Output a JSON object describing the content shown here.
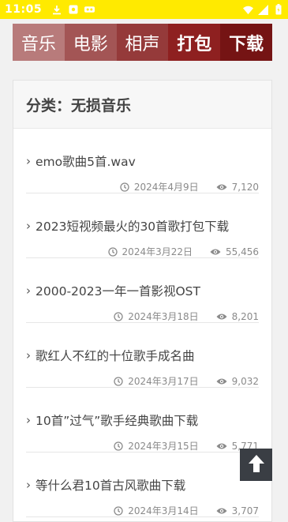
{
  "status_bar": {
    "time": "11:05",
    "icons": [
      "download-icon",
      "app-icon",
      "voicemail-icon",
      "wifi-icon",
      "signal-icon",
      "battery-icon"
    ]
  },
  "nav": {
    "tabs": [
      {
        "label": "音乐",
        "color": "#b87b7b"
      },
      {
        "label": "电影",
        "color": "#a35555"
      },
      {
        "label": "相声",
        "color": "#953a3a"
      },
      {
        "label": "打包",
        "color": "#8e2020"
      },
      {
        "label": "下载",
        "color": "#751414"
      }
    ]
  },
  "category": {
    "title": "分类：无损音乐"
  },
  "items": [
    {
      "title": "emo歌曲5首.wav",
      "date": "2024年4月9日",
      "views": "7,120"
    },
    {
      "title": "2023短视频最火的30首歌打包下载",
      "date": "2024年3月22日",
      "views": "55,456"
    },
    {
      "title": "2000-2023一年一首影视OST",
      "date": "2024年3月18日",
      "views": "8,201"
    },
    {
      "title": "歌红人不红的十位歌手成名曲",
      "date": "2024年3月17日",
      "views": "9,032"
    },
    {
      "title": "10首”过气”歌手经典歌曲下载",
      "date": "2024年3月15日",
      "views": "5,771"
    },
    {
      "title": "等什么君10首古风歌曲下载",
      "date": "2024年3月14日",
      "views": "3,707"
    }
  ],
  "colors": {
    "status_bar": "#ffea00",
    "back_to_top": "#3a3e44"
  }
}
